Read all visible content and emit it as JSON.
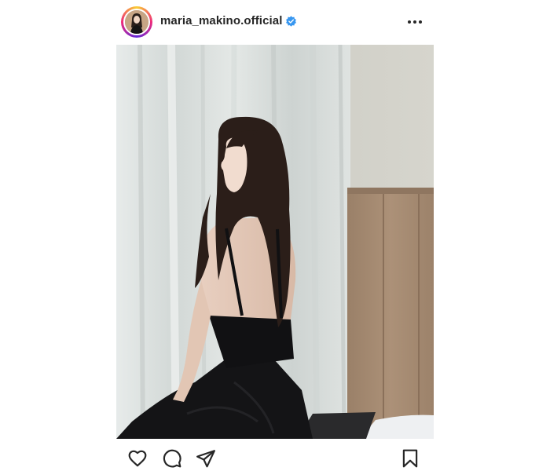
{
  "header": {
    "username": "maria_makino.official",
    "avatar_icon": "profile-avatar",
    "verified_icon": "verified-badge-icon",
    "verified_color": "#3897f0",
    "more_icon": "more-options-icon"
  },
  "post": {
    "photo_subject": "woman in black dress seated by curtained window"
  },
  "actions": {
    "like_icon": "heart-icon",
    "comment_icon": "comment-icon",
    "share_icon": "share-icon",
    "save_icon": "bookmark-icon"
  },
  "colors": {
    "text": "#262626",
    "story_ring": [
      "#f9ce34",
      "#ee2a7b",
      "#6228d7"
    ]
  }
}
